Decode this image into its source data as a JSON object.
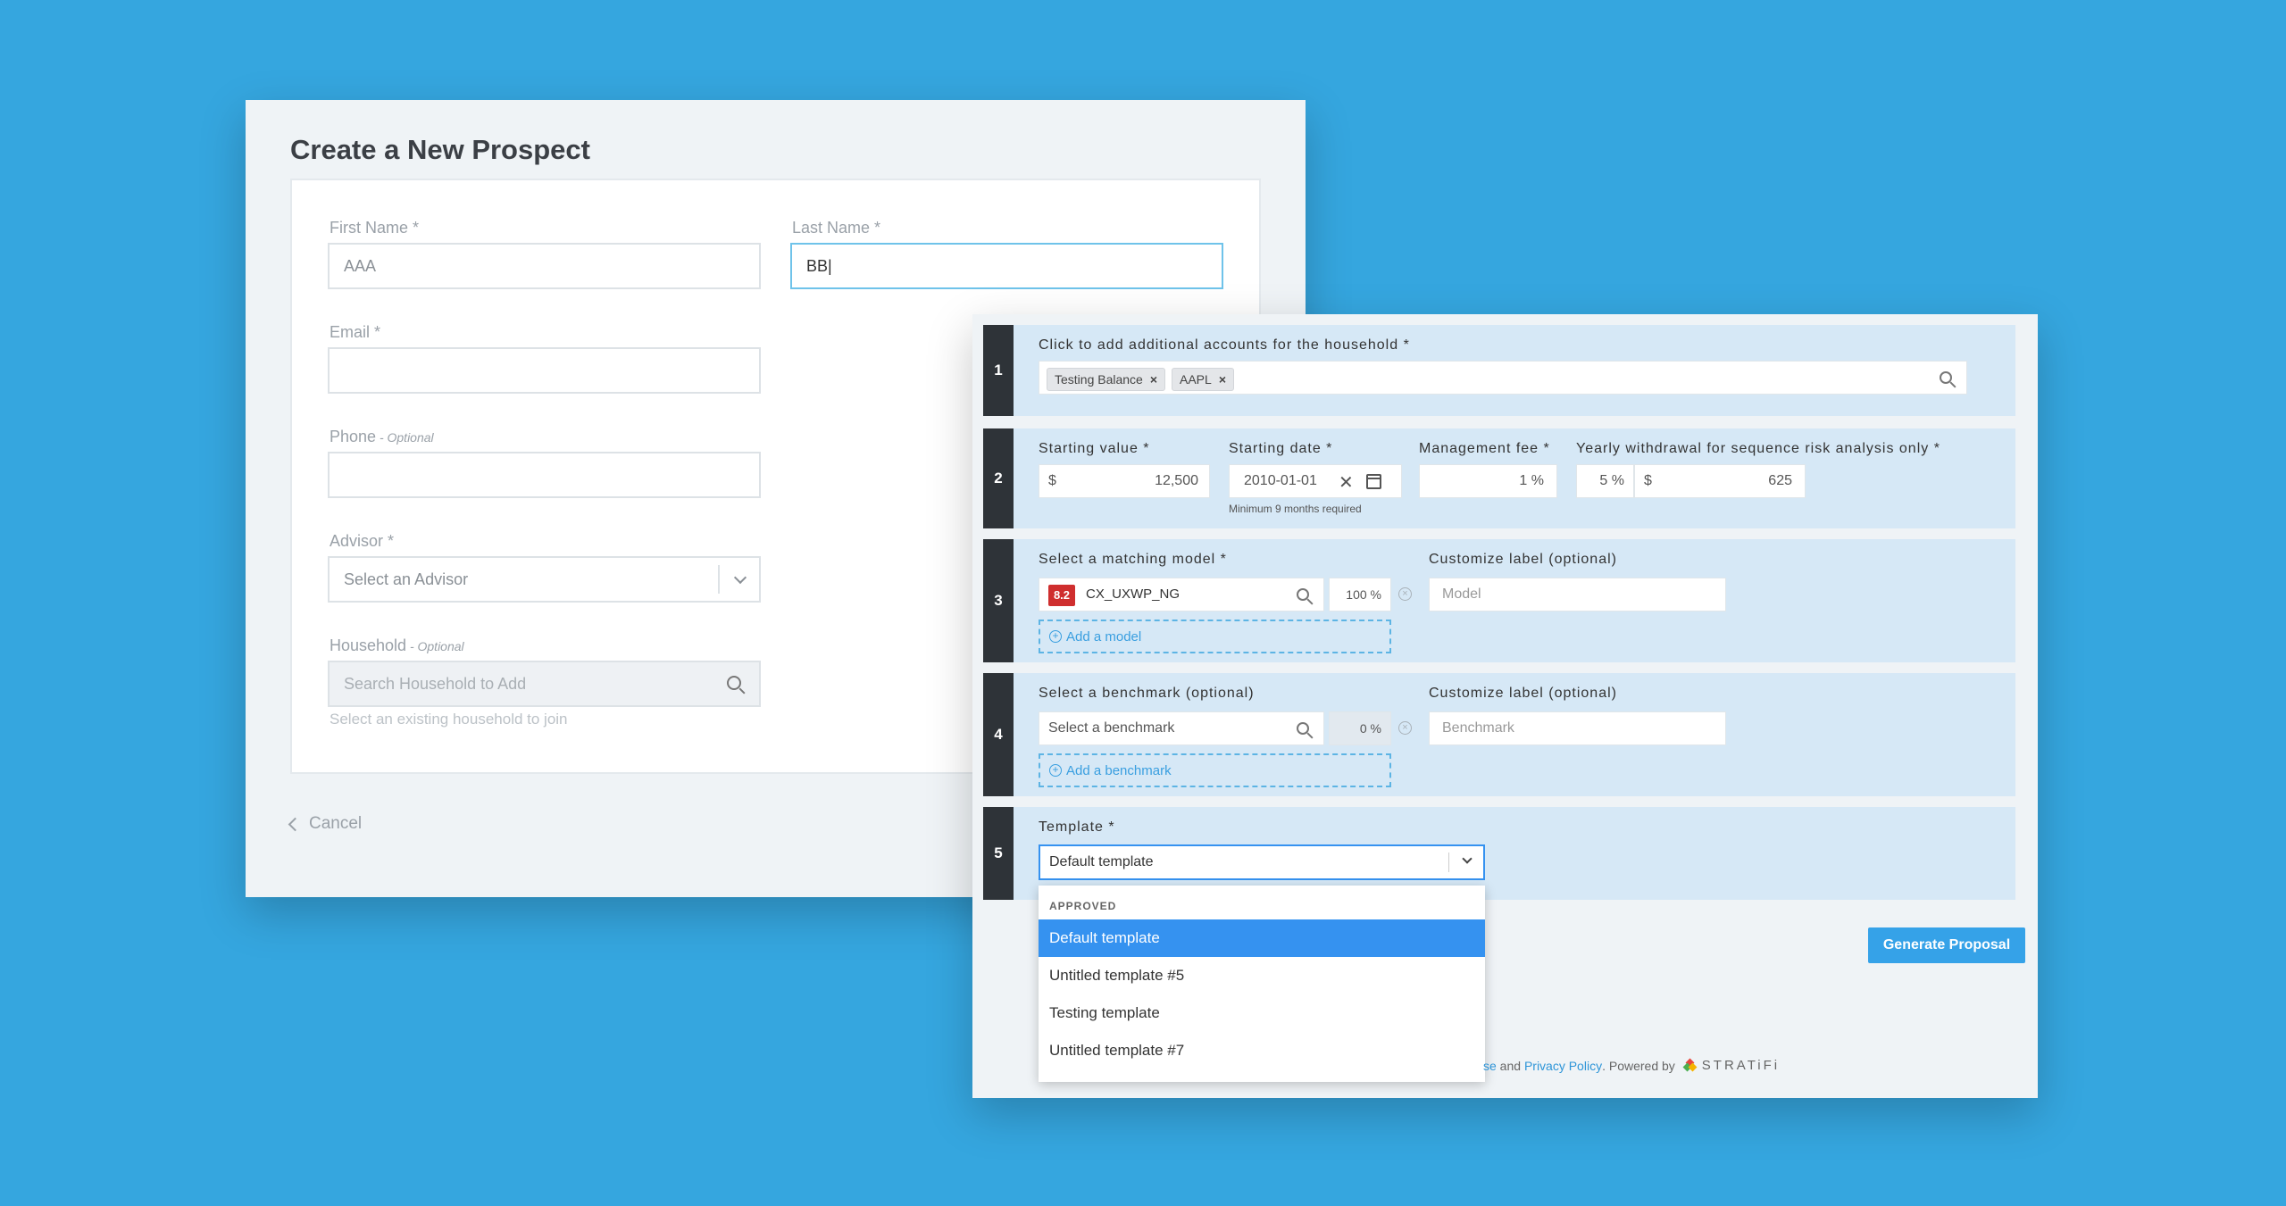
{
  "prospect": {
    "title": "Create a New Prospect",
    "first_name": {
      "label": "First Name *",
      "value": "AAA"
    },
    "last_name": {
      "label": "Last Name *",
      "value": "BB|"
    },
    "email": {
      "label": "Email *",
      "value": ""
    },
    "phone": {
      "label": "Phone",
      "optional": " - Optional",
      "value": ""
    },
    "advisor": {
      "label": "Advisor *",
      "placeholder": "Select an Advisor"
    },
    "household": {
      "label": "Household",
      "optional": " - Optional",
      "placeholder": "Search Household to Add",
      "hint": "Select an existing household to join"
    },
    "cancel_label": "Cancel"
  },
  "proposal": {
    "steps": [
      {
        "number": "1",
        "label": "Click to add additional accounts for the household *",
        "tags": [
          "Testing Balance",
          "AAPL"
        ],
        "tag_remove": "×"
      },
      {
        "number": "2",
        "starting_value": {
          "label": "Starting value *",
          "currency": "$",
          "value": "12,500"
        },
        "starting_date": {
          "label": "Starting date *",
          "value": "2010-01-01",
          "clear": "✕",
          "hint": "Minimum 9 months required"
        },
        "management_fee": {
          "label": "Management fee *",
          "value": "1",
          "unit": "%"
        },
        "withdrawal": {
          "label": "Yearly withdrawal for sequence risk analysis only *",
          "percent": "5",
          "unit": "%",
          "currency": "$",
          "amount": "625"
        }
      },
      {
        "number": "3",
        "label": "Select a matching model *",
        "model": {
          "score": "8.2",
          "name": "CX_UXWP_NG",
          "percent": "100",
          "unit": "%"
        },
        "add_label": "Add a model",
        "custom_label": {
          "label": "Customize label (optional)",
          "placeholder": "Model"
        }
      },
      {
        "number": "4",
        "label": "Select a benchmark (optional)",
        "benchmark": {
          "placeholder": "Select a benchmark",
          "percent": "0",
          "unit": "%"
        },
        "add_label": "Add a benchmark",
        "custom_label": {
          "label": "Customize label (optional)",
          "placeholder": "Benchmark"
        }
      },
      {
        "number": "5",
        "label": "Template *",
        "value": "Default template"
      }
    ],
    "dropdown": {
      "group": "APPROVED",
      "options": [
        "Default template",
        "Untitled template #5",
        "Testing template",
        "Untitled template #7"
      ],
      "selected_index": 0
    },
    "generate_label": "Generate Proposal",
    "footer": {
      "link1": "se",
      "and": " and ",
      "link2": "Privacy Policy",
      "powered": ". Powered by",
      "brand": "STRATiFi"
    }
  },
  "colors": {
    "background": "#35a6df",
    "accent": "#35a2e8",
    "step_bg": "#d6e8f6",
    "badge_red": "#cf2e2e",
    "selected": "#3592f0"
  }
}
